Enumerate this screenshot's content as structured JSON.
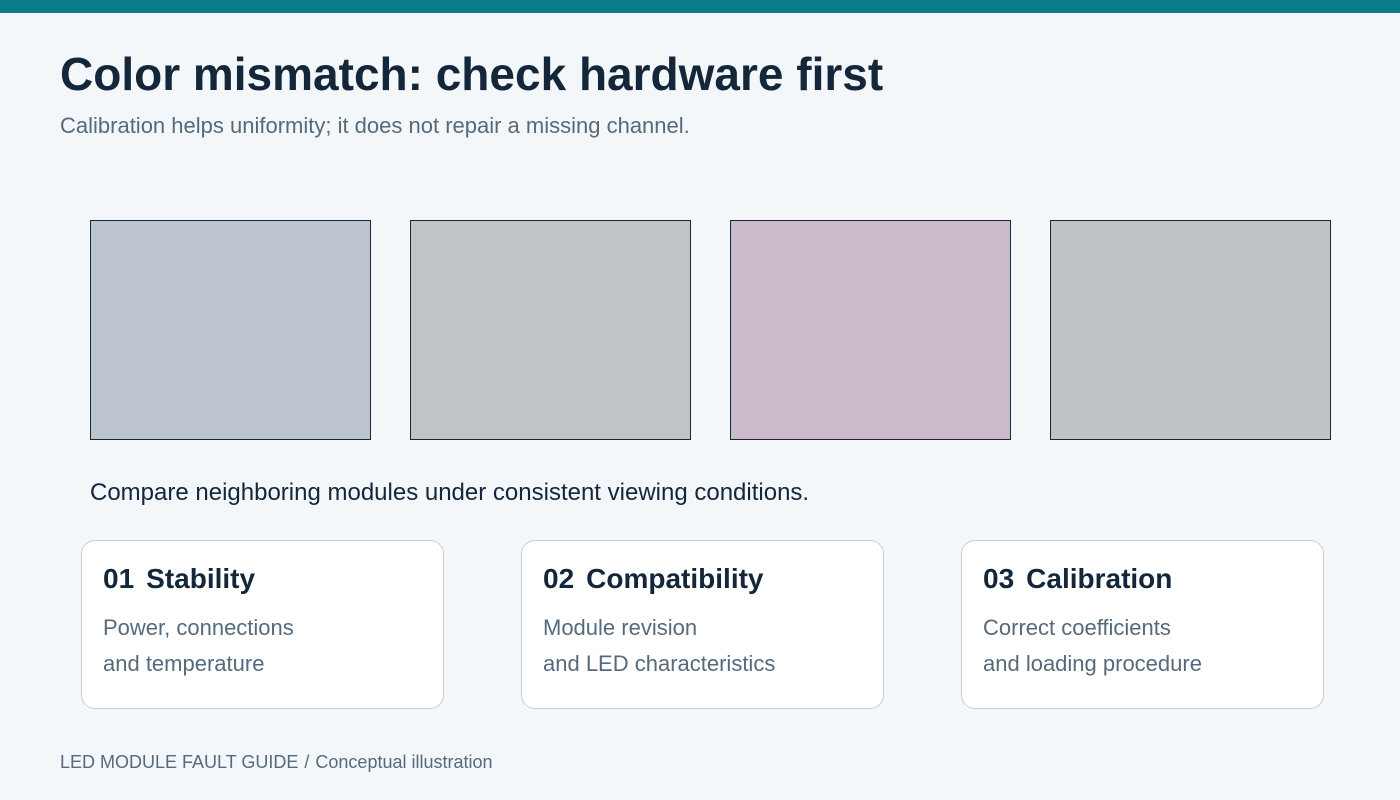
{
  "header": {
    "title": "Color mismatch: check hardware first",
    "subtitle": "Calibration helps uniformity; it does not repair a missing channel."
  },
  "swatches": [
    {
      "color": "#bcc5ce"
    },
    {
      "color": "#bec4c8"
    },
    {
      "color": "#cabaca"
    },
    {
      "color": "#bec3c6"
    }
  ],
  "caption": "Compare neighboring modules under consistent viewing conditions.",
  "cards": [
    {
      "number": "01",
      "title": "Stability",
      "line1": "Power, connections",
      "line2": "and temperature"
    },
    {
      "number": "02",
      "title": "Compatibility",
      "line1": "Module revision",
      "line2": "and LED characteristics"
    },
    {
      "number": "03",
      "title": "Calibration",
      "line1": "Correct coefficients",
      "line2": "and loading procedure"
    }
  ],
  "footer": {
    "guide": "LED MODULE FAULT GUIDE",
    "separator": "/",
    "note": "Conceptual illustration"
  },
  "colors": {
    "accent": "#0b7d8a",
    "background": "#f3f7fa",
    "text": "#13263a",
    "muted": "#556a7c"
  }
}
